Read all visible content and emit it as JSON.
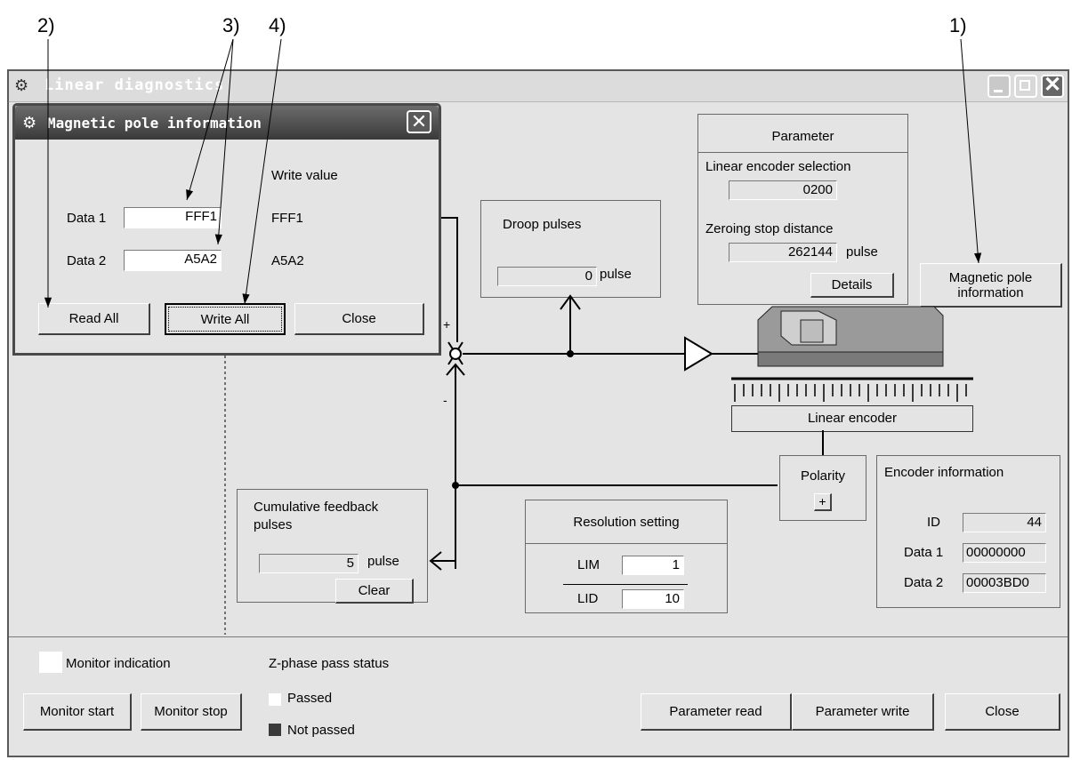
{
  "callouts": [
    "2)",
    "3)",
    "4)",
    "1)"
  ],
  "window": {
    "title": "Linear diagnostics",
    "sys_close": "✕"
  },
  "magnetic_dialog": {
    "title": "Magnetic pole information",
    "close_x": "✕",
    "write_value_header": "Write value",
    "data1_label": "Data 1",
    "data1_value": "FFF1",
    "data1_write": "FFF1",
    "data2_label": "Data 2",
    "data2_value": "A5A2",
    "data2_write": "A5A2",
    "read_all": "Read All",
    "write_all": "Write All",
    "close": "Close"
  },
  "parameter": {
    "title": "Parameter",
    "linear_encoder_selection_label": "Linear encoder selection",
    "linear_encoder_selection_value": "0200",
    "zeroing_stop_distance_label": "Zeroing stop distance",
    "zeroing_stop_distance_value": "262144",
    "unit": "pulse",
    "details": "Details"
  },
  "magnetic_pole_button": "Magnetic pole information",
  "droop": {
    "title": "Droop pulses",
    "value": "0",
    "unit": "pulse"
  },
  "diagram": {
    "plus": "+",
    "minus": "-",
    "linear_encoder_label": "Linear encoder"
  },
  "polarity": {
    "title": "Polarity",
    "value": "+"
  },
  "encoder_info": {
    "title": "Encoder information",
    "id_label": "ID",
    "id_value": "44",
    "data1_label": "Data 1",
    "data1_value": "00000000",
    "data2_label": "Data 2",
    "data2_value": "00003BD0"
  },
  "cumulative": {
    "title": "Cumulative feedback pulses",
    "value": "5",
    "unit": "pulse",
    "clear": "Clear"
  },
  "resolution": {
    "title": "Resolution setting",
    "lim_label": "LIM",
    "lim_value": "1",
    "lid_label": "LID",
    "lid_value": "10"
  },
  "bottom": {
    "monitor_indication": "Monitor indication",
    "zphase_title": "Z-phase pass status",
    "passed": "Passed",
    "not_passed": "Not passed",
    "monitor_start": "Monitor start",
    "monitor_stop": "Monitor stop",
    "parameter_read": "Parameter read",
    "parameter_write": "Parameter write",
    "close": "Close"
  }
}
